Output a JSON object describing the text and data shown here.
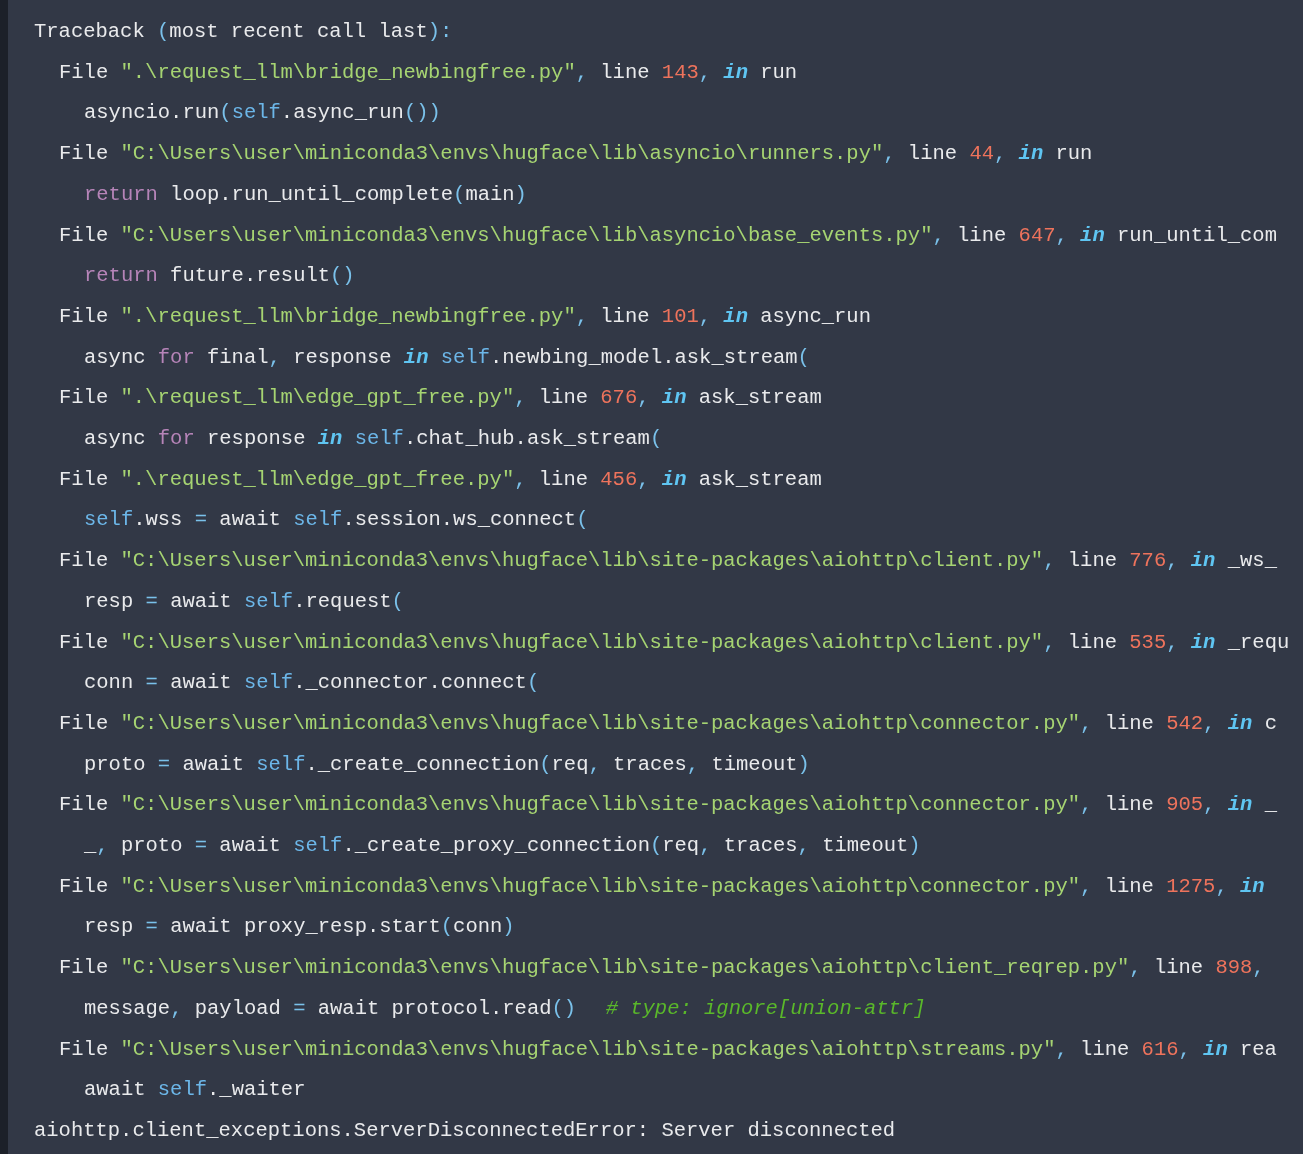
{
  "traceback": {
    "tokens": [
      {
        "kind": "plain",
        "text": "Traceback "
      },
      {
        "kind": "punc",
        "text": "("
      },
      {
        "kind": "plain",
        "text": "most recent call last"
      },
      {
        "kind": "punc",
        "text": "):"
      }
    ],
    "children": [
      {
        "tokens": [
          {
            "kind": "plain",
            "text": "File "
          },
          {
            "kind": "str",
            "text": "\".\\request_llm\\bridge_newbingfree.py\""
          },
          {
            "kind": "punc",
            "text": ", "
          },
          {
            "kind": "plain",
            "text": "line "
          },
          {
            "kind": "num",
            "text": "143"
          },
          {
            "kind": "punc",
            "text": ", "
          },
          {
            "kind": "kw",
            "text": "in"
          },
          {
            "kind": "plain",
            "text": " run"
          }
        ],
        "children": [
          {
            "tokens": [
              {
                "kind": "plain",
                "text": "asyncio.run"
              },
              {
                "kind": "punc",
                "text": "("
              },
              {
                "kind": "self",
                "text": "self"
              },
              {
                "kind": "plain",
                "text": ".async_run"
              },
              {
                "kind": "punc",
                "text": "())"
              }
            ]
          }
        ]
      },
      {
        "tokens": [
          {
            "kind": "plain",
            "text": "File "
          },
          {
            "kind": "str",
            "text": "\"C:\\Users\\user\\miniconda3\\envs\\hugface\\lib\\asyncio\\runners.py\""
          },
          {
            "kind": "punc",
            "text": ", "
          },
          {
            "kind": "plain",
            "text": "line "
          },
          {
            "kind": "num",
            "text": "44"
          },
          {
            "kind": "punc",
            "text": ", "
          },
          {
            "kind": "kw",
            "text": "in"
          },
          {
            "kind": "plain",
            "text": " run"
          }
        ],
        "children": [
          {
            "tokens": [
              {
                "kind": "ctl",
                "text": "return"
              },
              {
                "kind": "plain",
                "text": " loop.run_until_complete"
              },
              {
                "kind": "punc",
                "text": "("
              },
              {
                "kind": "plain",
                "text": "main"
              },
              {
                "kind": "punc",
                "text": ")"
              }
            ]
          }
        ]
      },
      {
        "tokens": [
          {
            "kind": "plain",
            "text": "File "
          },
          {
            "kind": "str",
            "text": "\"C:\\Users\\user\\miniconda3\\envs\\hugface\\lib\\asyncio\\base_events.py\""
          },
          {
            "kind": "punc",
            "text": ", "
          },
          {
            "kind": "plain",
            "text": "line "
          },
          {
            "kind": "num",
            "text": "647"
          },
          {
            "kind": "punc",
            "text": ", "
          },
          {
            "kind": "kw",
            "text": "in"
          },
          {
            "kind": "plain",
            "text": " run_until_com"
          }
        ],
        "children": [
          {
            "tokens": [
              {
                "kind": "ctl",
                "text": "return"
              },
              {
                "kind": "plain",
                "text": " future.result"
              },
              {
                "kind": "punc",
                "text": "()"
              }
            ]
          }
        ]
      },
      {
        "tokens": [
          {
            "kind": "plain",
            "text": "File "
          },
          {
            "kind": "str",
            "text": "\".\\request_llm\\bridge_newbingfree.py\""
          },
          {
            "kind": "punc",
            "text": ", "
          },
          {
            "kind": "plain",
            "text": "line "
          },
          {
            "kind": "num",
            "text": "101"
          },
          {
            "kind": "punc",
            "text": ", "
          },
          {
            "kind": "kw",
            "text": "in"
          },
          {
            "kind": "plain",
            "text": " async_run"
          }
        ],
        "children": [
          {
            "tokens": [
              {
                "kind": "plain",
                "text": "async "
              },
              {
                "kind": "ctl",
                "text": "for"
              },
              {
                "kind": "plain",
                "text": " final"
              },
              {
                "kind": "punc",
                "text": ", "
              },
              {
                "kind": "plain",
                "text": "response "
              },
              {
                "kind": "kw",
                "text": "in"
              },
              {
                "kind": "self",
                "text": " self"
              },
              {
                "kind": "plain",
                "text": ".newbing_model.ask_stream"
              },
              {
                "kind": "punc",
                "text": "("
              }
            ]
          }
        ]
      },
      {
        "tokens": [
          {
            "kind": "plain",
            "text": "File "
          },
          {
            "kind": "str",
            "text": "\".\\request_llm\\edge_gpt_free.py\""
          },
          {
            "kind": "punc",
            "text": ", "
          },
          {
            "kind": "plain",
            "text": "line "
          },
          {
            "kind": "num",
            "text": "676"
          },
          {
            "kind": "punc",
            "text": ", "
          },
          {
            "kind": "kw",
            "text": "in"
          },
          {
            "kind": "plain",
            "text": " ask_stream"
          }
        ],
        "children": [
          {
            "tokens": [
              {
                "kind": "plain",
                "text": "async "
              },
              {
                "kind": "ctl",
                "text": "for"
              },
              {
                "kind": "plain",
                "text": " response "
              },
              {
                "kind": "kw",
                "text": "in"
              },
              {
                "kind": "self",
                "text": " self"
              },
              {
                "kind": "plain",
                "text": ".chat_hub.ask_stream"
              },
              {
                "kind": "punc",
                "text": "("
              }
            ]
          }
        ]
      },
      {
        "tokens": [
          {
            "kind": "plain",
            "text": "File "
          },
          {
            "kind": "str",
            "text": "\".\\request_llm\\edge_gpt_free.py\""
          },
          {
            "kind": "punc",
            "text": ", "
          },
          {
            "kind": "plain",
            "text": "line "
          },
          {
            "kind": "num",
            "text": "456"
          },
          {
            "kind": "punc",
            "text": ", "
          },
          {
            "kind": "kw",
            "text": "in"
          },
          {
            "kind": "plain",
            "text": " ask_stream"
          }
        ],
        "children": [
          {
            "tokens": [
              {
                "kind": "self",
                "text": "self"
              },
              {
                "kind": "plain",
                "text": ".wss "
              },
              {
                "kind": "punc",
                "text": "="
              },
              {
                "kind": "plain",
                "text": " await "
              },
              {
                "kind": "self",
                "text": "self"
              },
              {
                "kind": "plain",
                "text": ".session.ws_connect"
              },
              {
                "kind": "punc",
                "text": "("
              }
            ]
          }
        ]
      },
      {
        "tokens": [
          {
            "kind": "plain",
            "text": "File "
          },
          {
            "kind": "str",
            "text": "\"C:\\Users\\user\\miniconda3\\envs\\hugface\\lib\\site-packages\\aiohttp\\client.py\""
          },
          {
            "kind": "punc",
            "text": ", "
          },
          {
            "kind": "plain",
            "text": "line "
          },
          {
            "kind": "num",
            "text": "776"
          },
          {
            "kind": "punc",
            "text": ", "
          },
          {
            "kind": "kw",
            "text": "in"
          },
          {
            "kind": "plain",
            "text": " _ws_"
          }
        ],
        "children": [
          {
            "tokens": [
              {
                "kind": "plain",
                "text": "resp "
              },
              {
                "kind": "punc",
                "text": "="
              },
              {
                "kind": "plain",
                "text": " await "
              },
              {
                "kind": "self",
                "text": "self"
              },
              {
                "kind": "plain",
                "text": ".request"
              },
              {
                "kind": "punc",
                "text": "("
              }
            ]
          }
        ]
      },
      {
        "tokens": [
          {
            "kind": "plain",
            "text": "File "
          },
          {
            "kind": "str",
            "text": "\"C:\\Users\\user\\miniconda3\\envs\\hugface\\lib\\site-packages\\aiohttp\\client.py\""
          },
          {
            "kind": "punc",
            "text": ", "
          },
          {
            "kind": "plain",
            "text": "line "
          },
          {
            "kind": "num",
            "text": "535"
          },
          {
            "kind": "punc",
            "text": ", "
          },
          {
            "kind": "kw",
            "text": "in"
          },
          {
            "kind": "plain",
            "text": " _requ"
          }
        ],
        "children": [
          {
            "tokens": [
              {
                "kind": "plain",
                "text": "conn "
              },
              {
                "kind": "punc",
                "text": "="
              },
              {
                "kind": "plain",
                "text": " await "
              },
              {
                "kind": "self",
                "text": "self"
              },
              {
                "kind": "plain",
                "text": "._connector.connect"
              },
              {
                "kind": "punc",
                "text": "("
              }
            ]
          }
        ]
      },
      {
        "tokens": [
          {
            "kind": "plain",
            "text": "File "
          },
          {
            "kind": "str",
            "text": "\"C:\\Users\\user\\miniconda3\\envs\\hugface\\lib\\site-packages\\aiohttp\\connector.py\""
          },
          {
            "kind": "punc",
            "text": ", "
          },
          {
            "kind": "plain",
            "text": "line "
          },
          {
            "kind": "num",
            "text": "542"
          },
          {
            "kind": "punc",
            "text": ", "
          },
          {
            "kind": "kw",
            "text": "in"
          },
          {
            "kind": "plain",
            "text": " c"
          }
        ],
        "children": [
          {
            "tokens": [
              {
                "kind": "plain",
                "text": "proto "
              },
              {
                "kind": "punc",
                "text": "="
              },
              {
                "kind": "plain",
                "text": " await "
              },
              {
                "kind": "self",
                "text": "self"
              },
              {
                "kind": "plain",
                "text": "._create_connection"
              },
              {
                "kind": "punc",
                "text": "("
              },
              {
                "kind": "plain",
                "text": "req"
              },
              {
                "kind": "punc",
                "text": ", "
              },
              {
                "kind": "plain",
                "text": "traces"
              },
              {
                "kind": "punc",
                "text": ", "
              },
              {
                "kind": "plain",
                "text": "timeout"
              },
              {
                "kind": "punc",
                "text": ")"
              }
            ]
          }
        ]
      },
      {
        "tokens": [
          {
            "kind": "plain",
            "text": "File "
          },
          {
            "kind": "str",
            "text": "\"C:\\Users\\user\\miniconda3\\envs\\hugface\\lib\\site-packages\\aiohttp\\connector.py\""
          },
          {
            "kind": "punc",
            "text": ", "
          },
          {
            "kind": "plain",
            "text": "line "
          },
          {
            "kind": "num",
            "text": "905"
          },
          {
            "kind": "punc",
            "text": ", "
          },
          {
            "kind": "kw",
            "text": "in"
          },
          {
            "kind": "plain",
            "text": " _"
          }
        ],
        "children": [
          {
            "tokens": [
              {
                "kind": "plain",
                "text": "_"
              },
              {
                "kind": "punc",
                "text": ", "
              },
              {
                "kind": "plain",
                "text": "proto "
              },
              {
                "kind": "punc",
                "text": "="
              },
              {
                "kind": "plain",
                "text": " await "
              },
              {
                "kind": "self",
                "text": "self"
              },
              {
                "kind": "plain",
                "text": "._create_proxy_connection"
              },
              {
                "kind": "punc",
                "text": "("
              },
              {
                "kind": "plain",
                "text": "req"
              },
              {
                "kind": "punc",
                "text": ", "
              },
              {
                "kind": "plain",
                "text": "traces"
              },
              {
                "kind": "punc",
                "text": ", "
              },
              {
                "kind": "plain",
                "text": "timeout"
              },
              {
                "kind": "punc",
                "text": ")"
              }
            ]
          }
        ]
      },
      {
        "tokens": [
          {
            "kind": "plain",
            "text": "File "
          },
          {
            "kind": "str",
            "text": "\"C:\\Users\\user\\miniconda3\\envs\\hugface\\lib\\site-packages\\aiohttp\\connector.py\""
          },
          {
            "kind": "punc",
            "text": ", "
          },
          {
            "kind": "plain",
            "text": "line "
          },
          {
            "kind": "num",
            "text": "1275"
          },
          {
            "kind": "punc",
            "text": ", "
          },
          {
            "kind": "kw",
            "text": "in"
          }
        ],
        "children": [
          {
            "tokens": [
              {
                "kind": "plain",
                "text": "resp "
              },
              {
                "kind": "punc",
                "text": "="
              },
              {
                "kind": "plain",
                "text": " await proxy_resp.start"
              },
              {
                "kind": "punc",
                "text": "("
              },
              {
                "kind": "plain",
                "text": "conn"
              },
              {
                "kind": "punc",
                "text": ")"
              }
            ]
          }
        ]
      },
      {
        "tokens": [
          {
            "kind": "plain",
            "text": "File "
          },
          {
            "kind": "str",
            "text": "\"C:\\Users\\user\\miniconda3\\envs\\hugface\\lib\\site-packages\\aiohttp\\client_reqrep.py\""
          },
          {
            "kind": "punc",
            "text": ", "
          },
          {
            "kind": "plain",
            "text": "line "
          },
          {
            "kind": "num",
            "text": "898"
          },
          {
            "kind": "punc",
            "text": ","
          }
        ],
        "children": [
          {
            "tokens": [
              {
                "kind": "plain",
                "text": "message"
              },
              {
                "kind": "punc",
                "text": ", "
              },
              {
                "kind": "plain",
                "text": "payload "
              },
              {
                "kind": "punc",
                "text": "="
              },
              {
                "kind": "plain",
                "text": " await protocol.read"
              },
              {
                "kind": "punc",
                "text": "()"
              },
              {
                "kind": "comment",
                "text": "# type: ignore[union-attr]"
              }
            ]
          }
        ]
      },
      {
        "tokens": [
          {
            "kind": "plain",
            "text": "File "
          },
          {
            "kind": "str",
            "text": "\"C:\\Users\\user\\miniconda3\\envs\\hugface\\lib\\site-packages\\aiohttp\\streams.py\""
          },
          {
            "kind": "punc",
            "text": ", "
          },
          {
            "kind": "plain",
            "text": "line "
          },
          {
            "kind": "num",
            "text": "616"
          },
          {
            "kind": "punc",
            "text": ", "
          },
          {
            "kind": "kw",
            "text": "in"
          },
          {
            "kind": "plain",
            "text": " rea"
          }
        ],
        "children": [
          {
            "tokens": [
              {
                "kind": "plain",
                "text": "await "
              },
              {
                "kind": "self",
                "text": "self"
              },
              {
                "kind": "plain",
                "text": "._waiter"
              }
            ]
          }
        ]
      }
    ]
  },
  "error": {
    "tokens": [
      {
        "kind": "plain",
        "text": "aiohttp.client_exceptions.ServerDisconnectedError: Server disconnected"
      }
    ]
  }
}
